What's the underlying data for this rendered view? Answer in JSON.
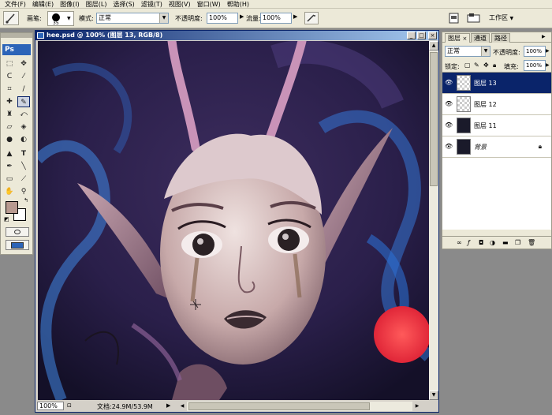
{
  "menu": [
    "文件(F)",
    "编辑(E)",
    "图像(I)",
    "图层(L)",
    "选择(S)",
    "滤镜(T)",
    "视图(V)",
    "窗口(W)",
    "帮助(H)"
  ],
  "options": {
    "brush_label": "画笔:",
    "brush_size": "35",
    "mode_label": "模式:",
    "mode_value": "正常",
    "opacity_label": "不透明度:",
    "opacity_value": "100%",
    "flow_label": "流量:",
    "flow_value": "100%",
    "workspace_label": "工作区"
  },
  "document": {
    "title": "hee.psd @ 100% (图层 13, RGB/8)",
    "zoom": "100%",
    "doc_size": "文档:24.9M/53.9M"
  },
  "layers_panel": {
    "tabs": [
      "图层",
      "通道",
      "路径"
    ],
    "blend_mode": "正常",
    "opacity_label": "不透明度:",
    "opacity_value": "100%",
    "lock_label": "锁定:",
    "fill_label": "填充:",
    "fill_value": "100%",
    "layers": [
      {
        "name": "图层 13",
        "selected": true,
        "thumb": "transparent"
      },
      {
        "name": "图层 12",
        "selected": false,
        "thumb": "transparent"
      },
      {
        "name": "图层 11",
        "selected": false,
        "thumb": "dark"
      },
      {
        "name": "背景",
        "selected": false,
        "thumb": "dark",
        "locked": true
      }
    ]
  },
  "toolbox": {
    "badge": "Ps"
  },
  "colors": {
    "foreground": "#b89a90",
    "background": "#ffffff",
    "title_bar": "#0a246a",
    "selected_layer": "#0a246a"
  }
}
